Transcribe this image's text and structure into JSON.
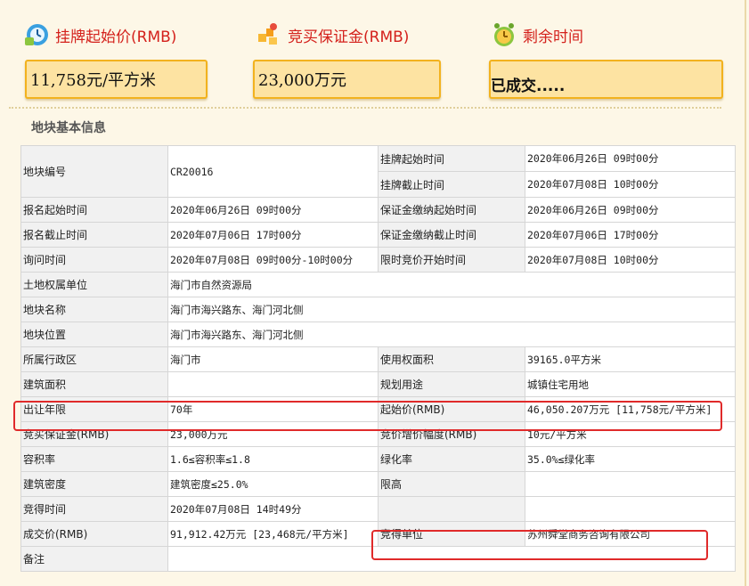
{
  "header": {
    "start_price_label": "挂牌起始价(RMB)",
    "start_price_value": "11,758元/平方米",
    "deposit_label": "竞买保证金(RMB)",
    "deposit_value": "23,000万元",
    "remaining_label": "剩余时间",
    "remaining_value": "已成交....."
  },
  "section_title": "地块基本信息",
  "table": {
    "r1": {
      "k1": "地块编号",
      "v1": "CR20016",
      "k2": "挂牌起始时间",
      "v2": "2020年06月26日 09时00分"
    },
    "r2": {
      "k2": "挂牌截止时间",
      "v2": "2020年07月08日 10时00分"
    },
    "r3": {
      "k1": "报名起始时间",
      "v1": "2020年06月26日 09时00分",
      "k2": "保证金缴纳起始时间",
      "v2": "2020年06月26日 09时00分"
    },
    "r4": {
      "k1": "报名截止时间",
      "v1": "2020年07月06日 17时00分",
      "k2": "保证金缴纳截止时间",
      "v2": "2020年07月06日 17时00分"
    },
    "r5": {
      "k1": "询问时间",
      "v1": "2020年07月08日 09时00分-10时00分",
      "k2": "限时竞价开始时间",
      "v2": "2020年07月08日 10时00分"
    },
    "r6": {
      "k1": "土地权属单位",
      "v1": "海门市自然资源局"
    },
    "r7": {
      "k1": "地块名称",
      "v1": "海门市海兴路东、海门河北侧"
    },
    "r8": {
      "k1": "地块位置",
      "v1": "海门市海兴路东、海门河北侧"
    },
    "r9": {
      "k1": "所属行政区",
      "v1": "海门市",
      "k2": "使用权面积",
      "v2": "39165.0平方米"
    },
    "r10": {
      "k1": "建筑面积",
      "v1": "",
      "k2": "规划用途",
      "v2": "城镇住宅用地"
    },
    "r11": {
      "k1": "出让年限",
      "v1": "70年",
      "k2": "起始价(RMB)",
      "v2": "46,050.207万元 [11,758元/平方米]"
    },
    "r12": {
      "k1": "竞买保证金(RMB)",
      "v1": "23,000万元",
      "k2": "竞价增价幅度(RMB)",
      "v2": "10元/平方米"
    },
    "r13": {
      "k1": "容积率",
      "v1": "1.6≤容积率≤1.8",
      "k2": "绿化率",
      "v2": "35.0%≤绿化率"
    },
    "r14": {
      "k1": "建筑密度",
      "v1": "建筑密度≤25.0%",
      "k2": "限高",
      "v2": ""
    },
    "r15": {
      "k1": "竞得时间",
      "v1": "2020年07月08日 14时49分",
      "k2": "",
      "v2": ""
    },
    "r16": {
      "k1": "成交价(RMB)",
      "v1": "91,912.42万元 [23,468元/平方米]",
      "k2": "竞得单位",
      "v2": "苏州舜堂商务咨询有限公司"
    },
    "r17": {
      "k1": "备注",
      "v1": ""
    }
  },
  "colors": {
    "label_red": "#d4211c",
    "box_fill": "#fde3a2",
    "box_border": "#f2b21e",
    "highlight": "#e02a2a"
  }
}
